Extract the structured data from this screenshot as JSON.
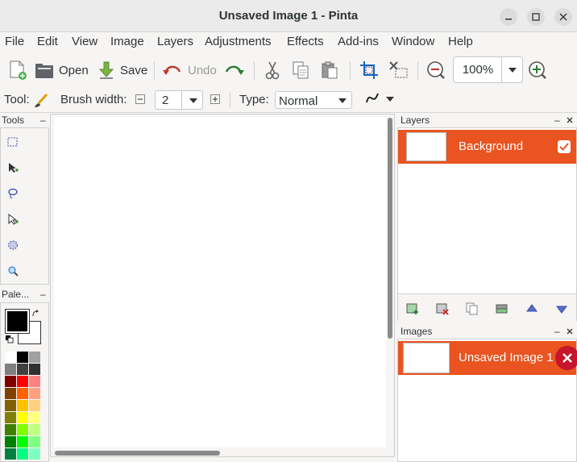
{
  "window": {
    "title": "Unsaved Image 1 - Pinta"
  },
  "menu": [
    "File",
    "Edit",
    "View",
    "Image",
    "Layers",
    "Adjustments",
    "Effects",
    "Add-ins",
    "Window",
    "Help"
  ],
  "toolbar": {
    "open": "Open",
    "save": "Save",
    "undo": "Undo",
    "zoom": "100%"
  },
  "options": {
    "tool_label": "Tool:",
    "brush_label": "Brush width:",
    "brush_value": "2",
    "type_label": "Type:",
    "type_value": "Normal"
  },
  "docks": {
    "tools": "Tools",
    "palette": "Pale...",
    "layers": "Layers",
    "images": "Images"
  },
  "layers": [
    {
      "name": "Background",
      "visible": true
    }
  ],
  "images": [
    {
      "name": "Unsaved Image 1"
    }
  ],
  "colors": {
    "accent": "#e95420",
    "primary": "#000000",
    "secondary": "#ffffff",
    "palette": [
      [
        "#ffffff",
        "#000000",
        "#a0a0a0"
      ],
      [
        "#808080",
        "#404040",
        "#303030"
      ],
      [
        "#800000",
        "#ff0000",
        "#ff8080"
      ],
      [
        "#804000",
        "#ff6000",
        "#ffa080"
      ],
      [
        "#806000",
        "#ffc000",
        "#ffd080"
      ],
      [
        "#808000",
        "#ffff00",
        "#ffff80"
      ],
      [
        "#408000",
        "#80ff00",
        "#c0ff80"
      ],
      [
        "#008000",
        "#00ff00",
        "#80ff80"
      ],
      [
        "#008040",
        "#00ff80",
        "#80ffc0"
      ]
    ]
  }
}
